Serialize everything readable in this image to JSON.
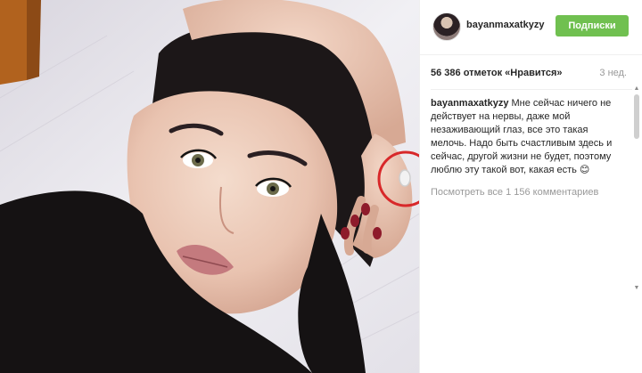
{
  "post": {
    "username": "bayanmaxatkyzy",
    "follow_label": "Подписки",
    "likes": "56 386 отметок «Нравится»",
    "time_ago": "3 нед.",
    "caption_user": "bayanmaxatkyzy",
    "caption_text": "Мне сейчас ничего не действует на нервы, даже мой незаживающий глаз, все это такая мелочь. Надо быть счастливым здесь и сейчас, другой жизни не будет, поэтому люблю эту такой вот, какая есть 😊",
    "view_comments": "Посмотреть все 1 156 комментариев"
  },
  "colors": {
    "follow_button": "#70c050",
    "highlight_circle": "#d8282a",
    "text_primary": "#262626",
    "text_secondary": "#999999"
  },
  "icons": {
    "scroll_up": "triangle-up-icon",
    "scroll_down": "triangle-down-icon"
  }
}
